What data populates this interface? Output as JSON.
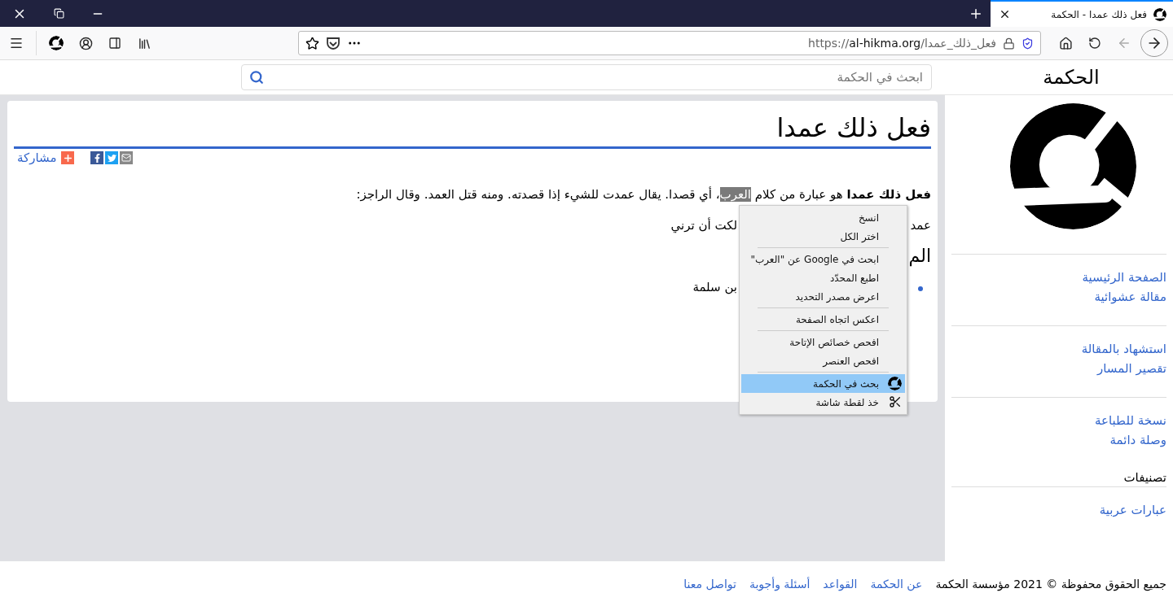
{
  "browser": {
    "tab": {
      "title": "فعل ذلك عمدا - الحكمة",
      "selected": true
    },
    "url": {
      "scheme": "https://",
      "host": "al-hikma.org",
      "path": "/فعل_ذلك_عمدا"
    }
  },
  "site": {
    "title": "الحكمة",
    "search": {
      "placeholder": "ابحث في الحكمة"
    }
  },
  "article": {
    "title": "فعل ذلك عمدا",
    "share": "مشاركة",
    "intro": [
      {
        "text": "**فعل ذلك عمدا** هو عبارة من كلام ",
        "selected": false
      },
      {
        "text": "العرب",
        "selected": true
      },
      {
        "text": "، أي قصدا. يقال عمدت للشيء إذا قصدته. ومنه قتل العمد. وقال الراجز:",
        "selected": false
      }
    ],
    "verse": {
      "right": "عمد",
      "left": "لكت أن ترني"
    },
    "section_heading": "الم",
    "bullet": "بن سلمة"
  },
  "context_menu": [
    {
      "kind": "item",
      "label": "انسخ",
      "selected": false
    },
    {
      "kind": "item",
      "label": "اختر الكل",
      "selected": false
    },
    {
      "kind": "separator"
    },
    {
      "kind": "item",
      "label": "ابحث في Google عن \"العرب\"",
      "selected": false
    },
    {
      "kind": "item",
      "label": "اطبع المحدّد",
      "selected": false
    },
    {
      "kind": "item",
      "label": "اعرض مصدر التحديد",
      "selected": false
    },
    {
      "kind": "separator"
    },
    {
      "kind": "item",
      "label": "اعكس اتجاه الصفحة",
      "selected": false
    },
    {
      "kind": "separator"
    },
    {
      "kind": "item",
      "label": "افحص خصائص الإتاحة",
      "selected": false
    },
    {
      "kind": "item",
      "label": "افحص العنصر",
      "selected": false
    },
    {
      "kind": "separator"
    },
    {
      "kind": "logo-item",
      "label": "بحث في الحكمة",
      "selected": true
    },
    {
      "kind": "screenshot-item",
      "label": "خذ لقطة شاشة",
      "selected": false
    }
  ],
  "sidebar": {
    "groups": [
      [
        "الصفحة الرئيسية",
        "مقالة عشوائية"
      ],
      [
        "استشهاد بالمقالة",
        "تقصير المسار"
      ],
      [
        "نسخة للطباعة",
        "وصلة دائمة"
      ]
    ],
    "categories_heading": "تصنيفات",
    "categories": [
      "عبارات عربية"
    ]
  },
  "footer": {
    "copyright": "جميع الحقوق محفوظة © 2021 مؤسسة الحكمة",
    "links": [
      "عن الحكمة",
      "القواعد",
      "أسئلة وأجوبة",
      "تواصل معنا"
    ]
  }
}
